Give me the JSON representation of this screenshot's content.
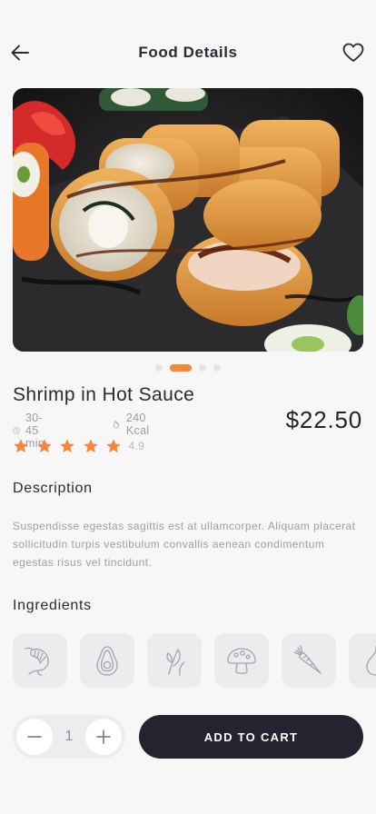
{
  "header": {
    "title": "Food Details",
    "back_icon": "arrow-left-icon",
    "favorite_icon": "heart-icon"
  },
  "carousel": {
    "image": "sushi-rolls-photo",
    "slide_count": 4,
    "active_index": 1
  },
  "food": {
    "name": "Shrimp in Hot Sauce",
    "time": "30-45 min",
    "calories": "240 Kcal",
    "price": "$22.50",
    "rating": "4.9",
    "stars": 5
  },
  "description": {
    "title": "Description",
    "text": "Suspendisse egestas sagittis est at ullamcorper. Aliquam placerat sollicitudin turpis vestibulum convallis aenean condimentum egestas risus vel tincidunt."
  },
  "ingredients": {
    "title": "Ingredients",
    "items": [
      "shrimp-icon",
      "avocado-icon",
      "herb-leaf-icon",
      "mushroom-icon",
      "carrot-icon",
      "onion-icon"
    ]
  },
  "cart": {
    "quantity": "1",
    "add_label": "ADD TO CART"
  },
  "colors": {
    "accent": "#f5863a",
    "dark": "#23242f",
    "background": "#f7f7f8"
  }
}
